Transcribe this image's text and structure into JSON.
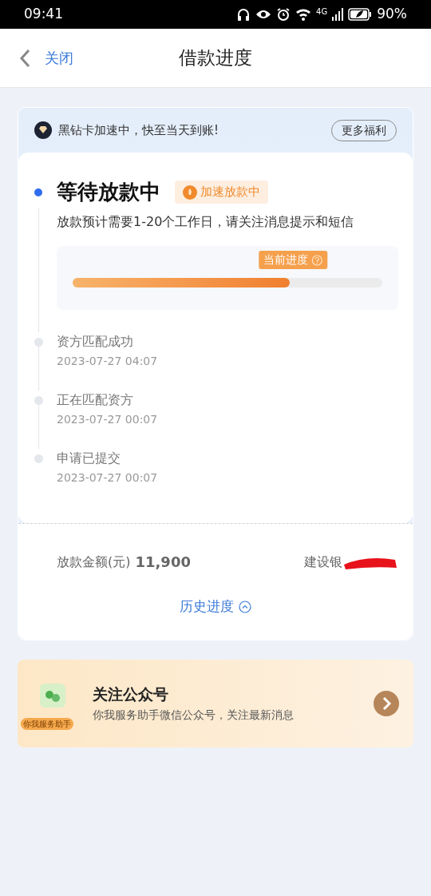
{
  "status_bar": {
    "time": "09:41",
    "network": "4G",
    "battery": "90%"
  },
  "nav": {
    "back": "关闭",
    "title": "借款进度"
  },
  "banner": {
    "text": "黑钻卡加速中，快至当天到账!",
    "button": "更多福利"
  },
  "current": {
    "title": "等待放款中",
    "badge": "加速放款中",
    "description": "放款预计需要1-20个工作日，请关注消息提示和短信",
    "progress_label": "当前进度",
    "level": 0.7
  },
  "timeline": [
    {
      "title": "资方匹配成功",
      "time": "2023-07-27 04:07"
    },
    {
      "title": "正在匹配资方",
      "time": "2023-07-27 00:07"
    },
    {
      "title": "申请已提交",
      "time": "2023-07-27 00:07"
    }
  ],
  "amount": {
    "label": "放款金额(元)",
    "value": "11,900",
    "bank": "建设银",
    "redacted": true
  },
  "history_link": "历史进度",
  "promo": {
    "badge": "你我服务助手",
    "title": "关注公众号",
    "subtitle": "你我服务助手微信公众号，关注最新消息"
  }
}
